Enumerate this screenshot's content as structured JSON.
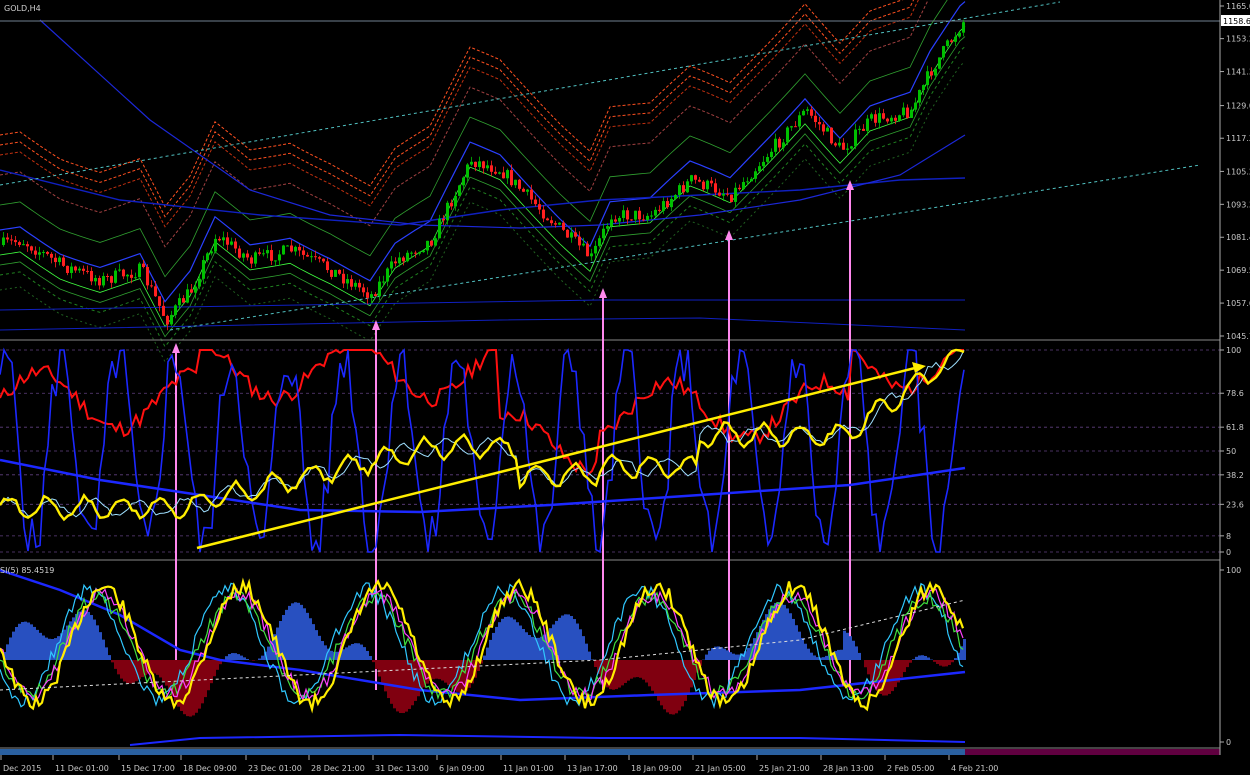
{
  "symbol": "GOLD,H4",
  "current_price": "1158.6",
  "indicator_label": "SI(5) 85.4519",
  "panels": {
    "price": {
      "ylim": [
        1045.7,
        1165.0
      ],
      "ticks": [
        "1165.0",
        "1153.2",
        "1141.3",
        "1129.0",
        "1117.2",
        "1105.2",
        "1093.3",
        "1081.4",
        "1069.5",
        "1057.6",
        "1045.7"
      ]
    },
    "oscillator": {
      "ylim": [
        0,
        100
      ],
      "ticks": [
        "100",
        "78.6",
        "61.8",
        "50",
        "38.2",
        "23.6",
        "8",
        "0"
      ]
    },
    "stochastic": {
      "ticks": [
        "100",
        "0"
      ]
    }
  },
  "xaxis": {
    "labels": [
      "Dec 2015",
      "11 Dec 01:00",
      "15 Dec 17:00",
      "18 Dec 09:00",
      "23 Dec 01:00",
      "28 Dec 21:00",
      "31 Dec 13:00",
      "6 Jan 09:00",
      "11 Jan 01:00",
      "13 Jan 17:00",
      "18 Jan 09:00",
      "21 Jan 05:00",
      "25 Jan 21:00",
      "28 Jan 13:00",
      "2 Feb 05:00",
      "4 Feb 21:00"
    ]
  },
  "colors": {
    "bull": "#00c000",
    "bear": "#ff2020",
    "grid": "#3a2a4a",
    "axis": "#aaaaaa",
    "pink": "#ff88ee",
    "yellow": "#ffee00",
    "blue": "#2030e0",
    "red": "#ff1010",
    "cyan": "#30c8ff",
    "histo_blue": "#2850c0",
    "histo_red": "#800010"
  }
}
